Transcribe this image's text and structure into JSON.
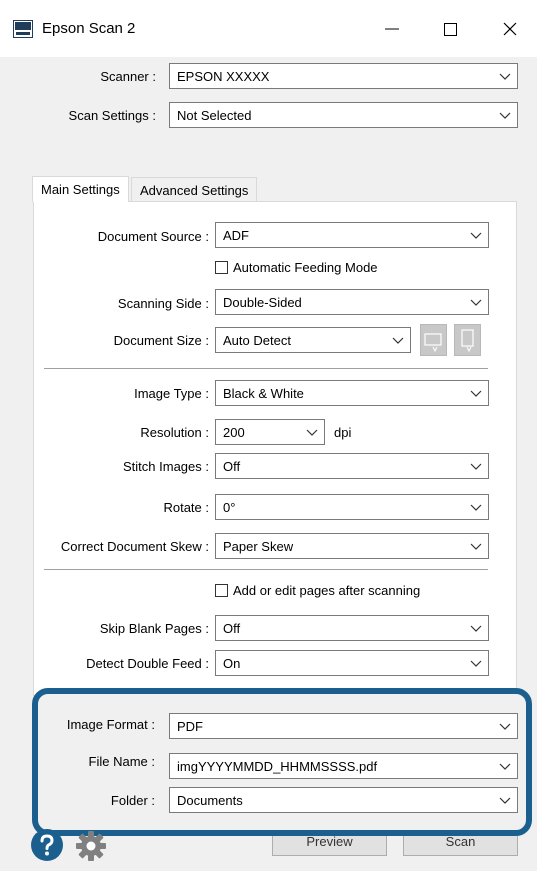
{
  "window": {
    "title": "Epson Scan 2",
    "icon": "scanner-app-icon"
  },
  "top": {
    "scanner_label": "Scanner :",
    "scanner_value": "EPSON XXXXX",
    "scan_settings_label": "Scan Settings :",
    "scan_settings_value": "Not Selected"
  },
  "tabs": [
    {
      "label": "Main Settings",
      "active": true
    },
    {
      "label": "Advanced Settings",
      "active": false
    }
  ],
  "main": {
    "document_source_label": "Document Source :",
    "document_source_value": "ADF",
    "auto_feed_label": "Automatic Feeding Mode",
    "scanning_side_label": "Scanning Side :",
    "scanning_side_value": "Double-Sided",
    "document_size_label": "Document Size :",
    "document_size_value": "Auto Detect",
    "image_type_label": "Image Type :",
    "image_type_value": "Black & White",
    "resolution_label": "Resolution :",
    "resolution_value": "200",
    "resolution_unit": "dpi",
    "stitch_label": "Stitch Images :",
    "stitch_value": "Off",
    "rotate_label": "Rotate :",
    "rotate_value": "0°",
    "skew_label": "Correct Document Skew :",
    "skew_value": "Paper Skew",
    "add_edit_label": "Add or edit pages after scanning",
    "skip_blank_label": "Skip Blank Pages :",
    "skip_blank_value": "Off",
    "double_feed_label": "Detect Double Feed :",
    "double_feed_value": "On"
  },
  "output": {
    "image_format_label": "Image Format :",
    "image_format_value": "PDF",
    "file_name_label": "File Name :",
    "file_name_value": "imgYYYYMMDD_HHMMSSSS.pdf",
    "folder_label": "Folder :",
    "folder_value": "Documents"
  },
  "buttons": {
    "preview": "Preview",
    "scan": "Scan"
  },
  "colors": {
    "highlight": "#1b5f8e",
    "help_icon": "#1b5f8e",
    "gear_icon": "#808080"
  }
}
